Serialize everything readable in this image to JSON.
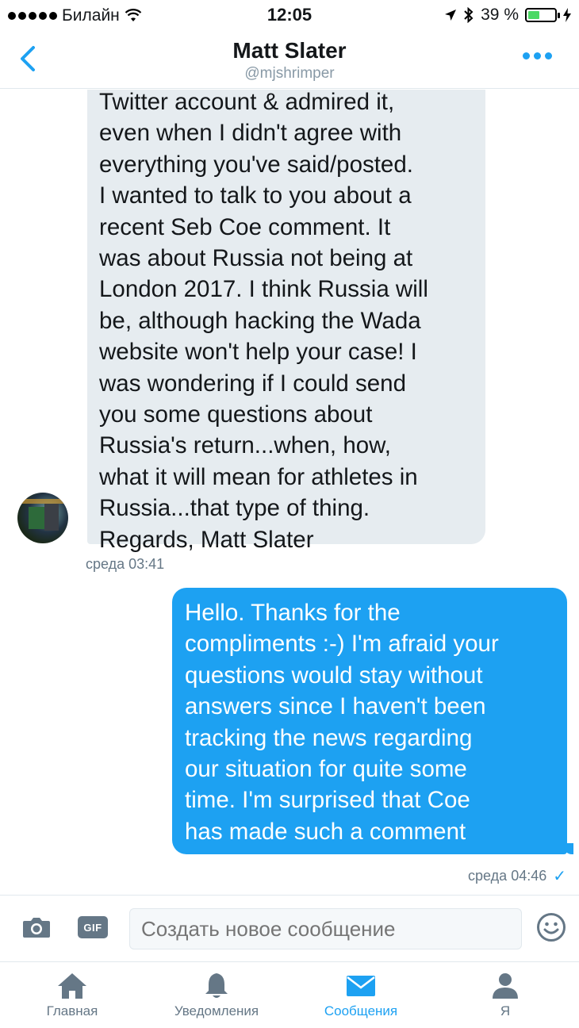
{
  "status_bar": {
    "carrier": "Билайн",
    "time": "12:05",
    "battery": "39 %"
  },
  "header": {
    "name": "Matt Slater",
    "handle": "@mjshrimper"
  },
  "messages": {
    "incoming": {
      "lines": [
        "Twitter account & admired it,",
        "even when I didn't agree with",
        "everything you've said/posted.",
        "I wanted to talk to you about a",
        "recent Seb Coe comment. It",
        "was about Russia not being at",
        "London 2017. I think Russia will",
        "be, although hacking the Wada",
        "website won't help your case! I",
        "was wondering if I could send",
        "you some questions about",
        "Russia's return...when, how,",
        "what it will mean for athletes in",
        "Russia...that type of thing.",
        "Regards, Matt Slater"
      ],
      "timestamp": "среда 03:41"
    },
    "outgoing": {
      "lines": [
        "Hello. Thanks for the",
        "compliments :-) I'm afraid your",
        "questions would stay without",
        "answers since I haven't been",
        "tracking the news regarding",
        "our situation for quite some",
        "time. I'm surprised that Coe",
        "has made such a comment"
      ],
      "timestamp": "среда 04:46",
      "read_mark": "✓"
    }
  },
  "composer": {
    "gif_label": "GIF",
    "placeholder": "Создать новое сообщение"
  },
  "tabs": [
    {
      "label": "Главная",
      "icon": "home-icon"
    },
    {
      "label": "Уведомления",
      "icon": "bell-icon"
    },
    {
      "label": "Сообщения",
      "icon": "envelope-icon",
      "active": true
    },
    {
      "label": "Я",
      "icon": "person-icon"
    }
  ],
  "colors": {
    "accent": "#1da1f2",
    "incoming_bubble": "#e6ecf0",
    "muted": "#657786"
  }
}
